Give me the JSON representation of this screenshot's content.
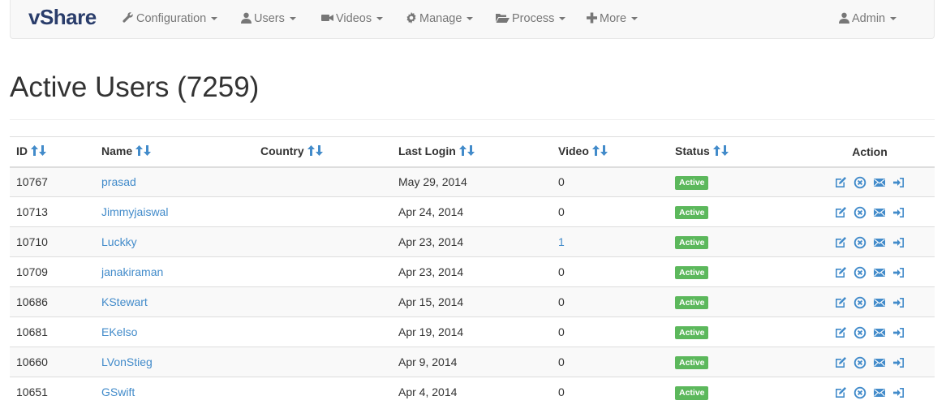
{
  "brand": "vShare",
  "nav": {
    "configuration": "Configuration",
    "users": "Users",
    "videos": "Videos",
    "manage": "Manage",
    "process": "Process",
    "more": "More",
    "admin": "Admin"
  },
  "page_title": "Active Users (7259)",
  "table": {
    "headers": {
      "id": "ID",
      "name": "Name",
      "country": "Country",
      "last_login": "Last Login",
      "video": "Video",
      "status": "Status",
      "action": "Action"
    },
    "rows": [
      {
        "id": "10767",
        "name": "prasad",
        "country": "",
        "last_login": "May 29, 2014",
        "video": "0",
        "video_link": false,
        "status": "Active"
      },
      {
        "id": "10713",
        "name": "Jimmyjaiswal",
        "country": "",
        "last_login": "Apr 24, 2014",
        "video": "0",
        "video_link": false,
        "status": "Active"
      },
      {
        "id": "10710",
        "name": "Luckky",
        "country": "",
        "last_login": "Apr 23, 2014",
        "video": "1",
        "video_link": true,
        "status": "Active"
      },
      {
        "id": "10709",
        "name": "janakiraman",
        "country": "",
        "last_login": "Apr 23, 2014",
        "video": "0",
        "video_link": false,
        "status": "Active"
      },
      {
        "id": "10686",
        "name": "KStewart",
        "country": "",
        "last_login": "Apr 15, 2014",
        "video": "0",
        "video_link": false,
        "status": "Active"
      },
      {
        "id": "10681",
        "name": "EKelso",
        "country": "",
        "last_login": "Apr 19, 2014",
        "video": "0",
        "video_link": false,
        "status": "Active"
      },
      {
        "id": "10660",
        "name": "LVonStieg",
        "country": "",
        "last_login": "Apr 9, 2014",
        "video": "0",
        "video_link": false,
        "status": "Active"
      },
      {
        "id": "10651",
        "name": "GSwift",
        "country": "",
        "last_login": "Apr 4, 2014",
        "video": "0",
        "video_link": false,
        "status": "Active"
      }
    ],
    "action_icons": [
      "edit-icon",
      "remove-circle-icon",
      "envelope-icon",
      "login-icon"
    ]
  },
  "colors": {
    "brand": "#2a3d6b",
    "link": "#428bca",
    "status_active": "#5cb85c",
    "nav_text": "#777777",
    "navbar_bg": "#f8f8f8"
  }
}
